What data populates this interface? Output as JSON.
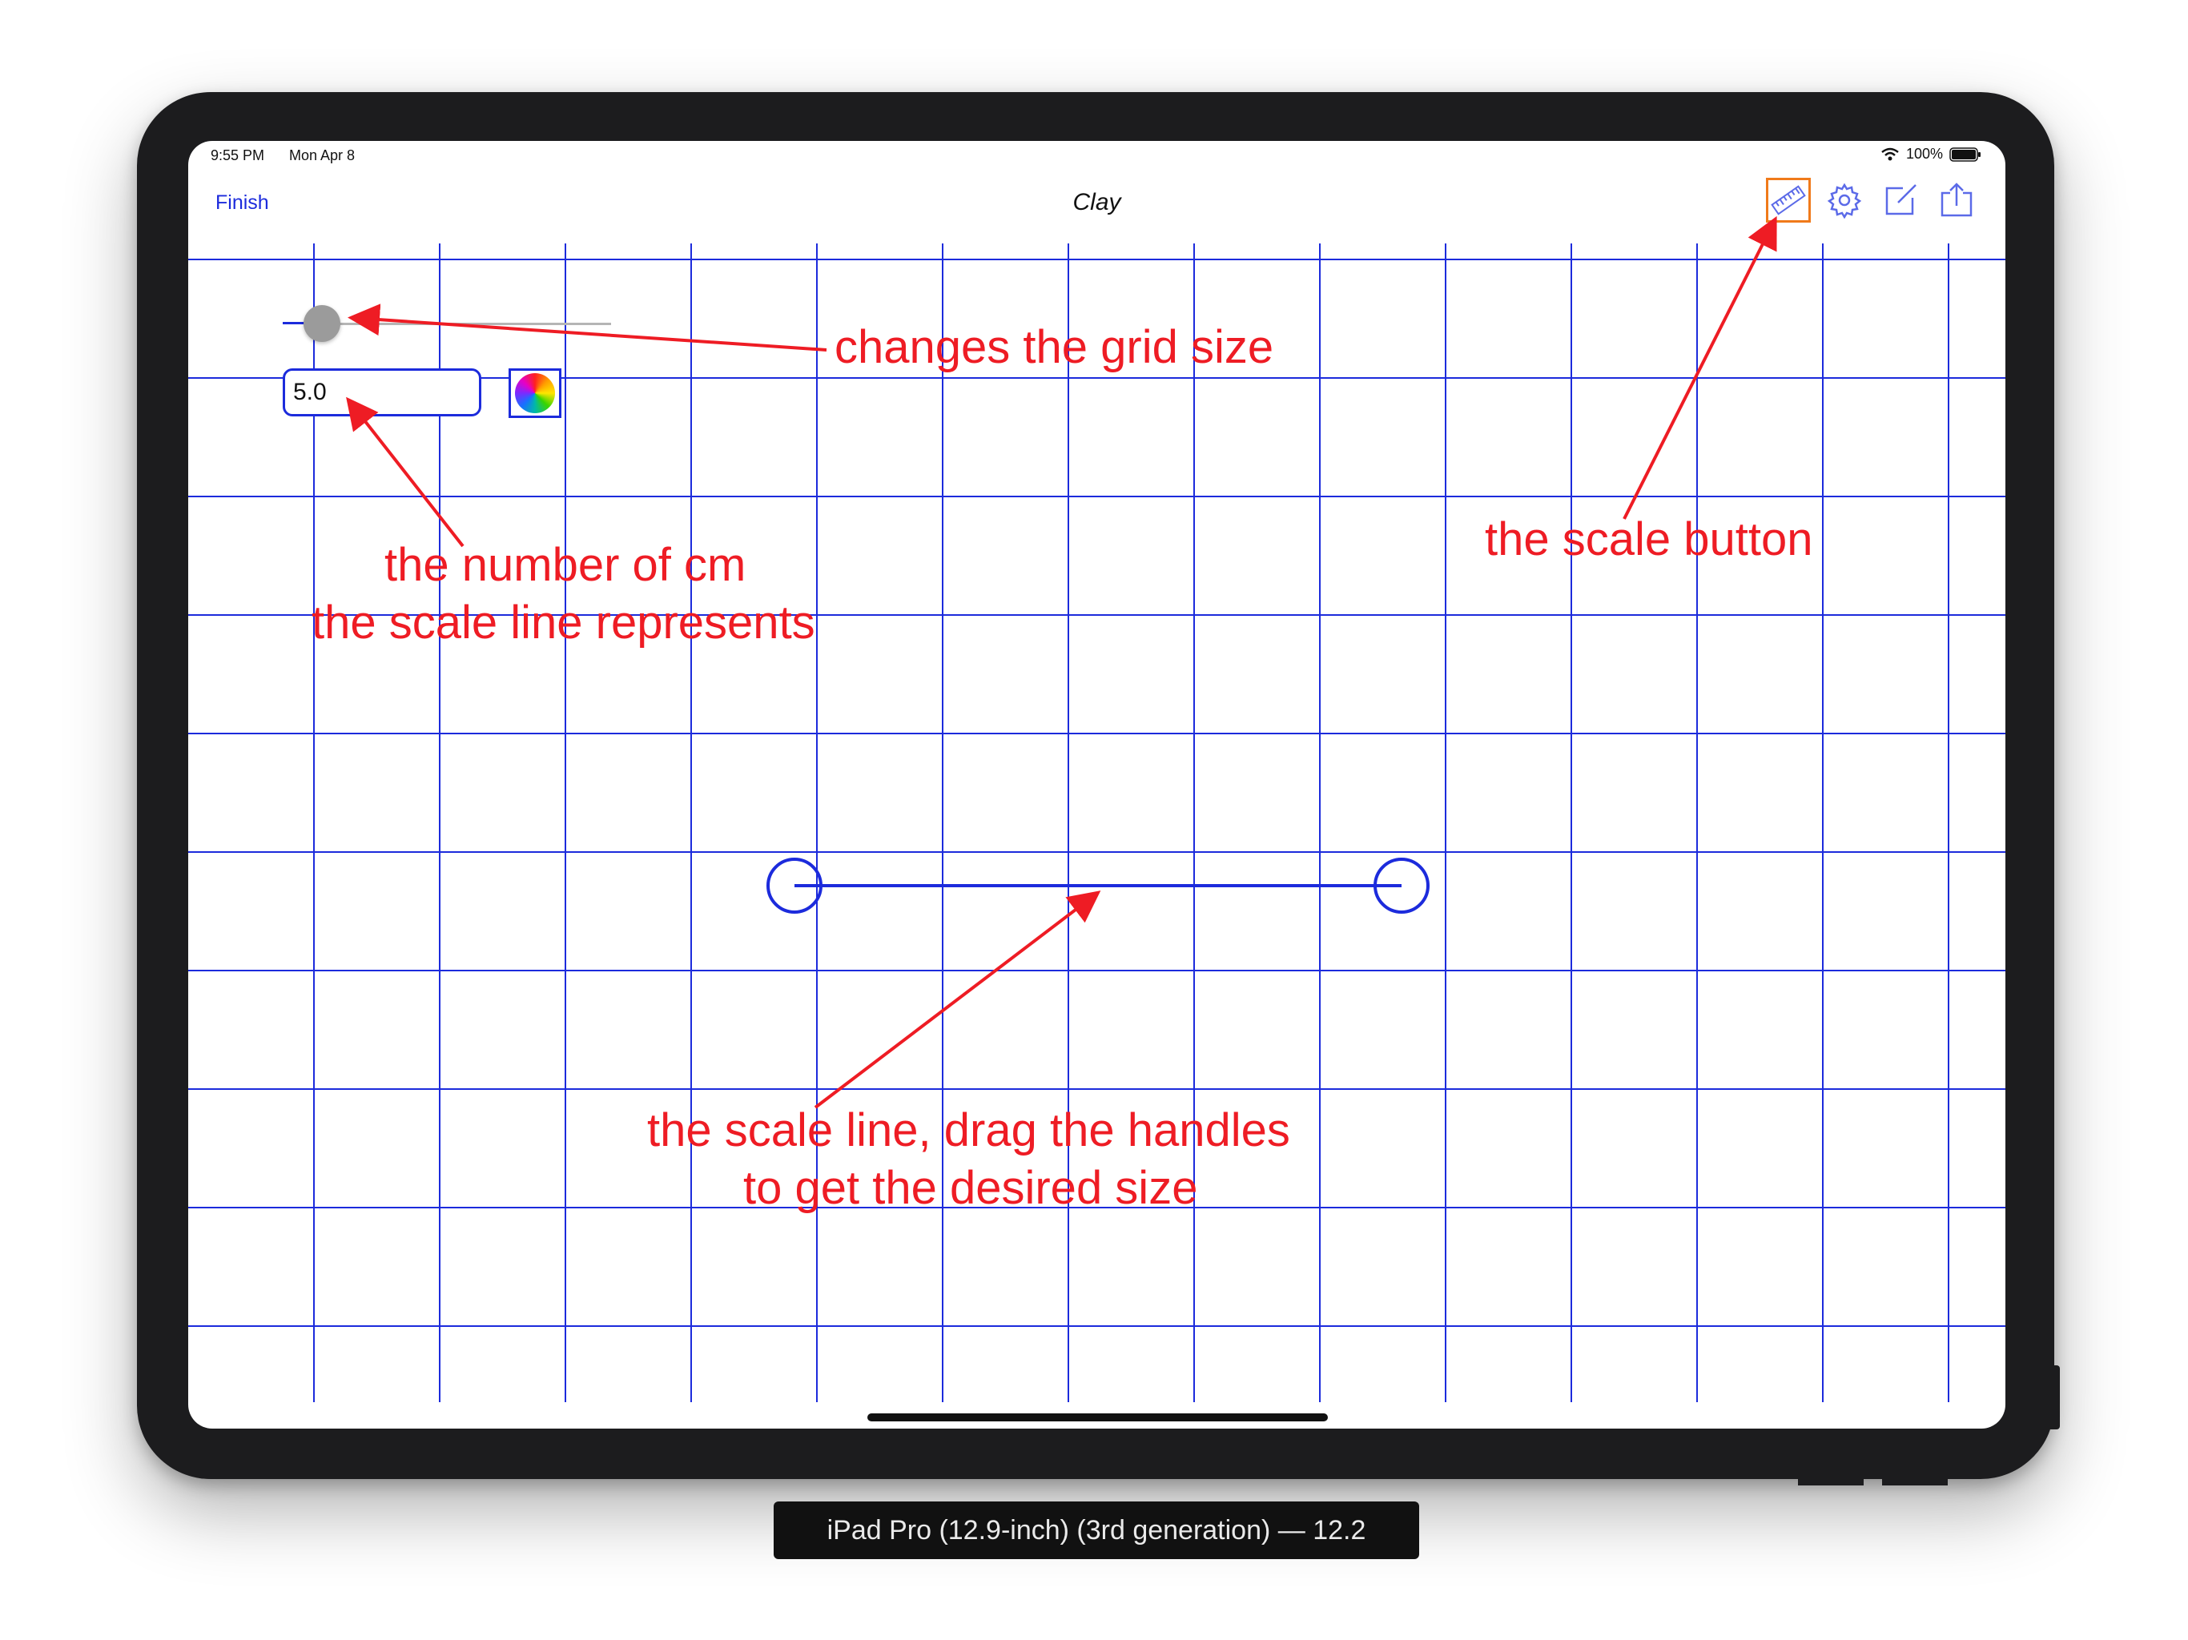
{
  "status_bar": {
    "time": "9:55 PM",
    "date": "Mon Apr 8",
    "battery": "100%"
  },
  "nav": {
    "left_button": "Finish",
    "title": "Clay",
    "icons": [
      "ruler-icon",
      "gear-icon",
      "compose-icon",
      "share-icon"
    ]
  },
  "controls": {
    "grid_size_slider_fraction": 0.09,
    "cm_value": "5.0",
    "color_picker_icon": "color-wheel-icon"
  },
  "annotations": {
    "grid_size": "changes the grid size",
    "cm_line1": "the number of cm",
    "cm_line2": "the scale line represents",
    "scale_button": "the scale button",
    "scale_line1": "the scale line, drag the handles",
    "scale_line2": "to get the desired size"
  },
  "device_caption": "iPad Pro (12.9-inch) (3rd generation) — 12.2",
  "colors": {
    "grid": "#1c2bdc",
    "accent": "#1c2bdc",
    "annotation": "#ee1c24",
    "scale_button_highlight": "#f07a1a",
    "bezel": "#1c1c1e"
  }
}
